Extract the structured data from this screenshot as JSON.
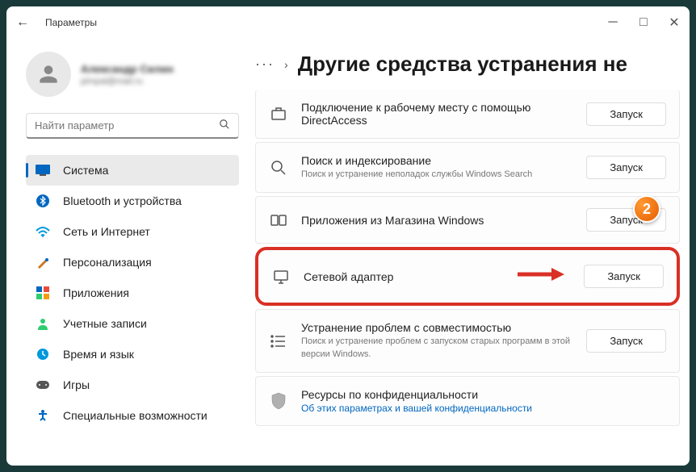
{
  "app_title": "Параметры",
  "profile": {
    "name": "Александр Силин",
    "email": "pimpal@mail.ru"
  },
  "search": {
    "placeholder": "Найти параметр"
  },
  "nav": [
    {
      "icon": "system",
      "label": "Система",
      "active": true
    },
    {
      "icon": "bluetooth",
      "label": "Bluetooth и устройства"
    },
    {
      "icon": "network",
      "label": "Сеть и Интернет"
    },
    {
      "icon": "personalization",
      "label": "Персонализация"
    },
    {
      "icon": "apps",
      "label": "Приложения"
    },
    {
      "icon": "accounts",
      "label": "Учетные записи"
    },
    {
      "icon": "time",
      "label": "Время и язык"
    },
    {
      "icon": "gaming",
      "label": "Игры"
    },
    {
      "icon": "accessibility",
      "label": "Специальные возможности"
    }
  ],
  "page_title": "Другие средства устранения не",
  "launch_label": "Запуск",
  "items": [
    {
      "title": "Подключение к рабочему месту с помощью DirectAccess",
      "desc": ""
    },
    {
      "title": "Поиск и индексирование",
      "desc": "Поиск и устранение неполадок службы Windows Search"
    },
    {
      "title": "Приложения из Магазина Windows",
      "desc": ""
    },
    {
      "title": "Сетевой адаптер",
      "desc": "",
      "highlighted": true
    },
    {
      "title": "Устранение проблем с совместимостью",
      "desc": "Поиск и устранение проблем с запуском старых программ в этой версии Windows."
    },
    {
      "title": "Ресурсы по конфиденциальности",
      "link": "Об этих параметрах и вашей конфиденциальности"
    }
  ],
  "badge": "2"
}
